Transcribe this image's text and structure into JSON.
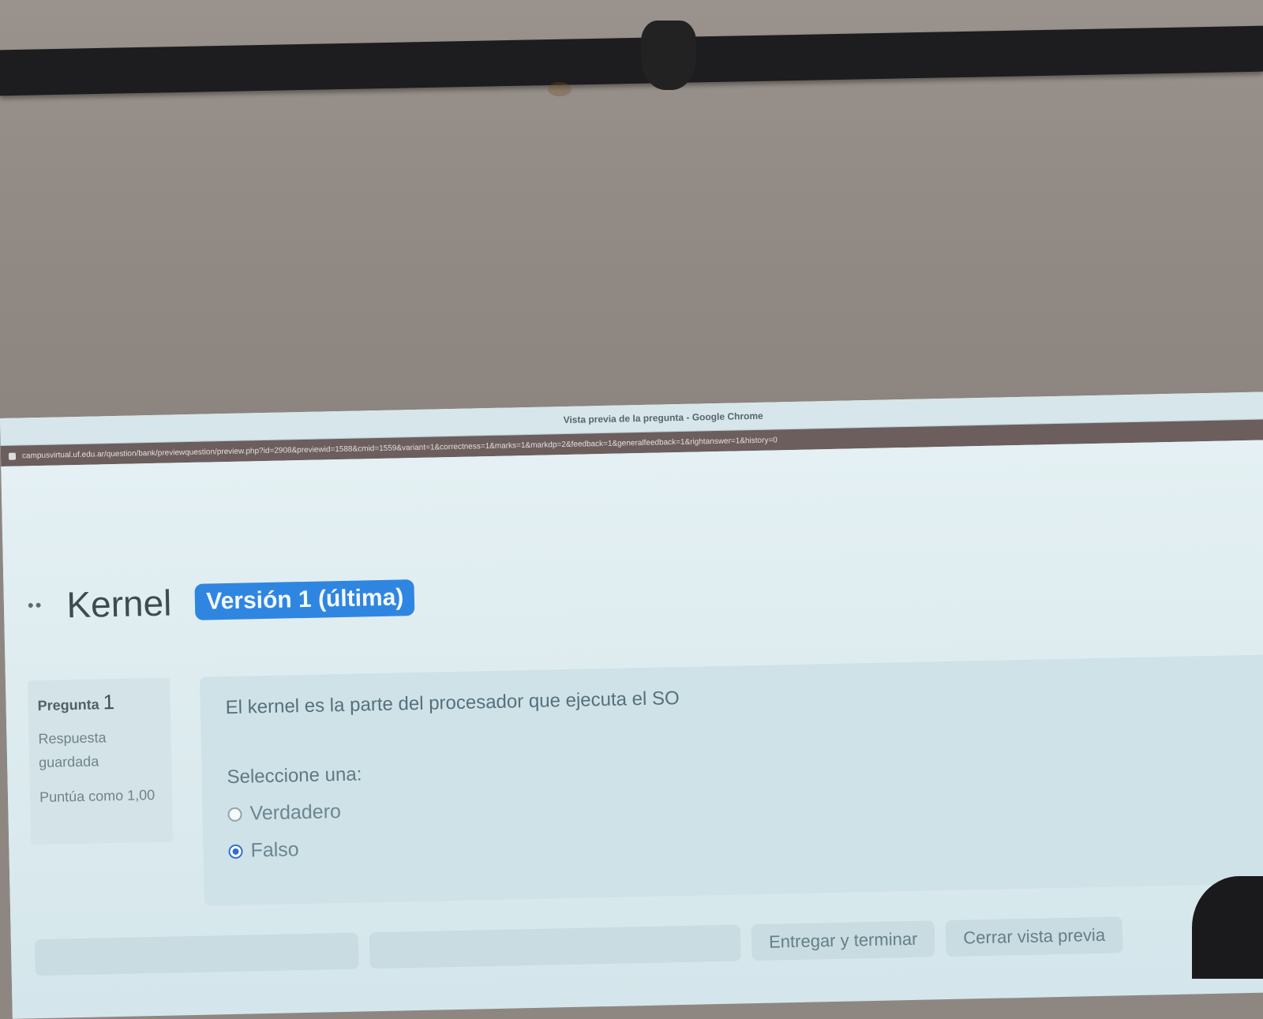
{
  "window": {
    "title": "Vista previa de la pregunta - Google Chrome",
    "url": "campusvirtual.uf.edu.ar/question/bank/previewquestion/preview.php?id=2908&previewid=1588&cmid=1559&variant=1&correctness=1&marks=1&markdp=2&feedback=1&generalfeedback=1&rightanswer=1&history=0"
  },
  "header": {
    "title": "Kernel",
    "version_badge": "Versión 1 (última)"
  },
  "question_info": {
    "label": "Pregunta",
    "number": "1",
    "status": "Respuesta guardada",
    "score": "Puntúa como 1,00"
  },
  "question": {
    "text": "El kernel es la parte del procesador que ejecuta el SO",
    "prompt": "Seleccione una:",
    "options": [
      {
        "label": "Verdadero",
        "selected": false
      },
      {
        "label": "Falso",
        "selected": true
      }
    ]
  },
  "buttons": {
    "submit": "Entregar y terminar",
    "close_preview": "Cerrar vista previa"
  },
  "colors": {
    "accent": "#2f86e0",
    "selected_radio": "#2f6fd0"
  }
}
